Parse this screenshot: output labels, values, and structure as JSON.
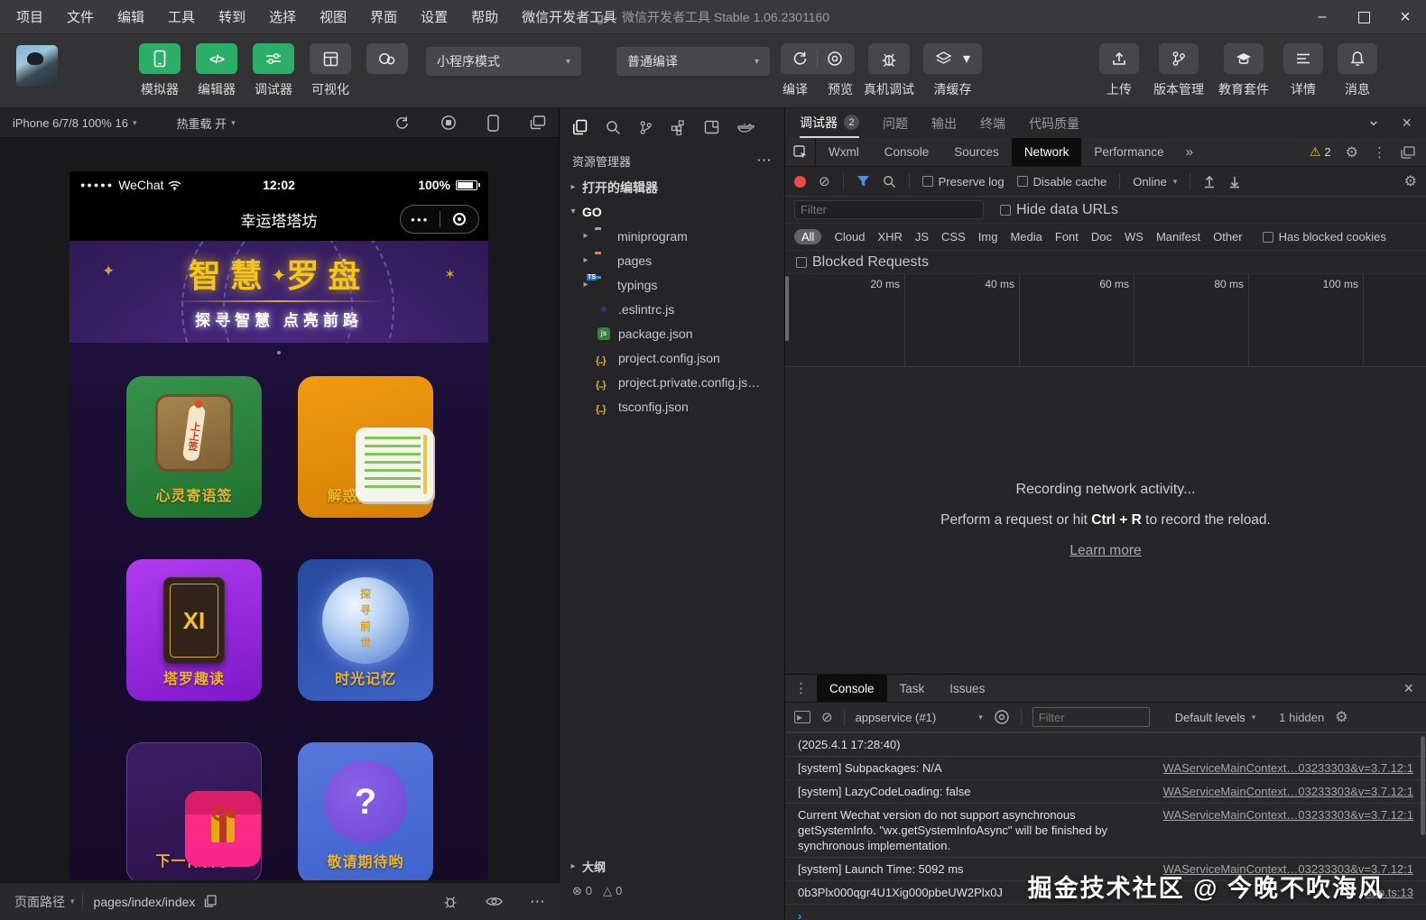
{
  "window": {
    "menu": [
      "项目",
      "文件",
      "编辑",
      "工具",
      "转到",
      "选择",
      "视图",
      "界面",
      "设置",
      "帮助",
      "微信开发者工具"
    ],
    "title": "go · 微信开发者工具 Stable 1.06.2301160"
  },
  "toolbar": {
    "modes": [
      {
        "label": "模拟器"
      },
      {
        "label": "编辑器"
      },
      {
        "label": "调试器"
      },
      {
        "label": "可视化"
      },
      {
        "label": "云开发"
      }
    ],
    "mode_select": "小程序模式",
    "compile_select": "普通编译",
    "actions": [
      {
        "label": "编译"
      },
      {
        "label": "预览"
      },
      {
        "label": "真机调试"
      },
      {
        "label": "清缓存"
      }
    ],
    "right_buttons": [
      {
        "label": "上传"
      },
      {
        "label": "版本管理"
      },
      {
        "label": "教育套件"
      },
      {
        "label": "详情"
      },
      {
        "label": "消息"
      }
    ]
  },
  "simulator": {
    "device": "iPhone 6/7/8 100% 16",
    "hot_reload": "热重载 开",
    "status": {
      "carrier": "WeChat",
      "time": "12:02",
      "battery": "100%"
    },
    "nav_title": "幸运塔塔坊",
    "banner": {
      "title_left": "智慧",
      "title_right": "罗盘",
      "subtitle": "探寻智慧 点亮前路"
    },
    "cards": [
      {
        "label": "心灵寄语签",
        "stick_text": "上上签"
      },
      {
        "label": "解惑指南书"
      },
      {
        "label": "塔罗趣读",
        "numeral": "XI"
      },
      {
        "label": "时光记忆",
        "ball_text": "探寻前世"
      },
      {
        "label": "下一件喜事"
      },
      {
        "label": "敬请期待哟",
        "mark": "?"
      }
    ],
    "footer": {
      "label": "页面路径",
      "path": "pages/index/index"
    }
  },
  "explorer": {
    "title": "资源管理器",
    "open_editors": "打开的编辑器",
    "project": "GO",
    "tree": [
      {
        "name": "miniprogram"
      },
      {
        "name": "pages"
      },
      {
        "name": "typings"
      },
      {
        "name": ".eslintrc.js"
      },
      {
        "name": "package.json"
      },
      {
        "name": "project.config.json"
      },
      {
        "name": "project.private.config.js…"
      },
      {
        "name": "tsconfig.json"
      }
    ],
    "outline": "大纲",
    "errors": "0",
    "warnings": "0"
  },
  "debugger": {
    "tabs": [
      {
        "label": "调试器",
        "badge": "2"
      },
      {
        "label": "问题"
      },
      {
        "label": "输出"
      },
      {
        "label": "终端"
      },
      {
        "label": "代码质量"
      }
    ],
    "devtools_tabs": [
      {
        "label": "Wxml"
      },
      {
        "label": "Console"
      },
      {
        "label": "Sources"
      },
      {
        "label": "Network"
      },
      {
        "label": "Performance"
      }
    ],
    "warning_count": "2"
  },
  "network": {
    "preserve_log": "Preserve log",
    "disable_cache": "Disable cache",
    "throttle": "Online",
    "filter_placeholder": "Filter",
    "hide_data_urls": "Hide data URLs",
    "types": [
      "All",
      "Cloud",
      "XHR",
      "JS",
      "CSS",
      "Img",
      "Media",
      "Font",
      "Doc",
      "WS",
      "Manifest",
      "Other"
    ],
    "has_blocked_cookies": "Has blocked cookies",
    "blocked_requests": "Blocked Requests",
    "ticks": [
      "20 ms",
      "40 ms",
      "60 ms",
      "80 ms",
      "100 ms"
    ],
    "message": {
      "title": "Recording network activity...",
      "line_pre": "Perform a request or hit ",
      "key": "Ctrl + R",
      "line_post": " to record the reload.",
      "link": "Learn more"
    }
  },
  "console": {
    "tabs": [
      {
        "label": "Console"
      },
      {
        "label": "Task"
      },
      {
        "label": "Issues"
      }
    ],
    "context": "appservice (#1)",
    "filter_placeholder": "Filter",
    "levels": "Default levels",
    "hidden": "1 hidden",
    "logs": [
      {
        "text": "(2025.4.1 17:28:40)",
        "source": ""
      },
      {
        "text": "[system] Subpackages: N/A",
        "source": "WAServiceMainContext…03233303&v=3.7.12:1"
      },
      {
        "text": "[system] LazyCodeLoading: false",
        "source": "WAServiceMainContext…03233303&v=3.7.12:1"
      },
      {
        "text": "Current Wechat version do not support asynchronous getSystemInfo. \"wx.getSystemInfoAsync\" will be finished by synchronous implementation.",
        "source": "WAServiceMainContext…03233303&v=3.7.12:1"
      },
      {
        "text": "[system] Launch Time: 5092 ms",
        "source": "WAServiceMainContext…03233303&v=3.7.12:1"
      },
      {
        "text": "0b3Plx000qgr4U1Xig000pbeUW2Plx0J",
        "source": "app.ts:13"
      }
    ]
  },
  "watermark": "掘金技术社区 @ 今晚不吹海风",
  "colors": {
    "wechat_green": "#2aae68",
    "record_red": "#ef4b4b",
    "filter_blue": "#4596e8",
    "warning_yellow": "#e9c21b",
    "card_label_gold": "#f0b429",
    "banner_gold": "#f5c518",
    "prompt_blue": "#4a8bf5"
  }
}
